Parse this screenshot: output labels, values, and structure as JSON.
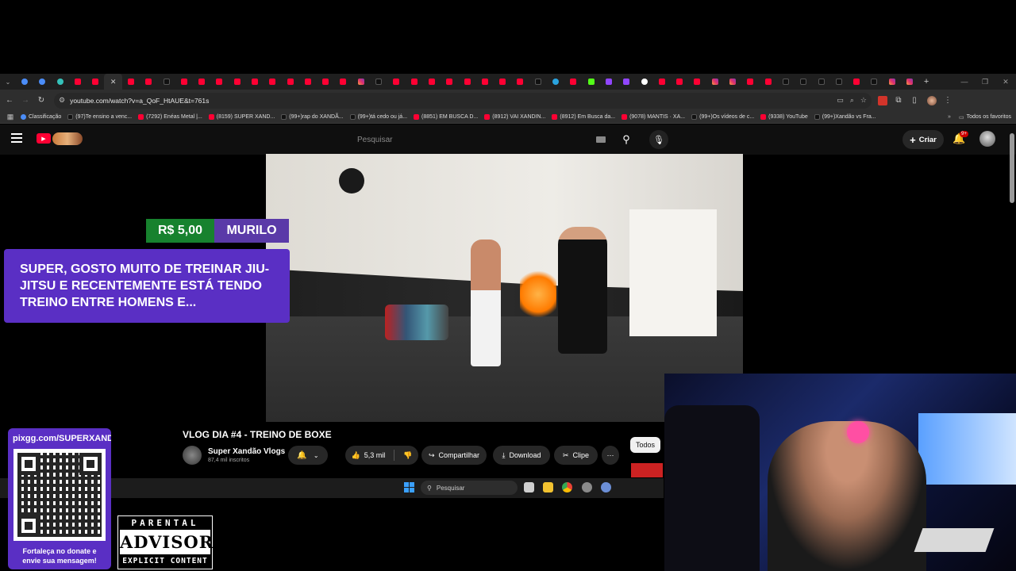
{
  "browser": {
    "url": "youtube.com/watch?v=a_QoF_HtAUE&t=761s",
    "tabs_favicons": [
      "link",
      "link",
      "ai",
      "yt",
      "yt",
      "close",
      "yt",
      "yt",
      "tt",
      "yt",
      "yt",
      "yt",
      "yt",
      "yt",
      "yt",
      "yt",
      "yt",
      "yt",
      "yt",
      "ig",
      "tt",
      "yt",
      "yt",
      "yt",
      "yt",
      "yt",
      "yt",
      "yt",
      "yt",
      "tt",
      "tg",
      "yt",
      "kick",
      "tw",
      "tw",
      "gg",
      "yt",
      "yt",
      "yt",
      "ig",
      "ig",
      "yt",
      "yt",
      "tt",
      "tt",
      "tt",
      "tt",
      "yt",
      "tt",
      "ig",
      "ig"
    ],
    "new_tab_label": "+",
    "all_bookmarks_label": "Todos os favoritos",
    "bookmarks": [
      {
        "icon": "link",
        "label": "Classificação"
      },
      {
        "icon": "tt",
        "label": "(97)Te ensino a venc..."
      },
      {
        "icon": "yt",
        "label": "(7292) Enéas Metal |..."
      },
      {
        "icon": "yt",
        "label": "(8159) SUPER XAND..."
      },
      {
        "icon": "tt",
        "label": "(99+)rap do XANDÃ..."
      },
      {
        "icon": "tt",
        "label": "(99+)tá cedo ou já..."
      },
      {
        "icon": "yt",
        "label": "(8851) EM BUSCA D..."
      },
      {
        "icon": "yt",
        "label": "(8912) VAI XANDIN..."
      },
      {
        "icon": "yt",
        "label": "(8912) Em Busca da..."
      },
      {
        "icon": "yt",
        "label": "(9078) MANTIS · XA..."
      },
      {
        "icon": "tt",
        "label": "(99+)Os vídeos de c..."
      },
      {
        "icon": "yt",
        "label": "(9338) YouTube"
      },
      {
        "icon": "tt",
        "label": "(99+)Xandão vs Fra..."
      }
    ]
  },
  "youtube": {
    "search_placeholder": "Pesquisar",
    "create_label": "Criar",
    "notifications_badge": "9+",
    "video": {
      "title": "VLOG DIA #4 - TREINO DE BOXE",
      "channel_name": "Super Xandão Vlogs",
      "subscribers": "87,4 mil inscritos",
      "likes": "5,3 mil",
      "share_label": "Compartilhar",
      "download_label": "Download",
      "clip_label": "Clipe"
    },
    "chip_label": "Todos"
  },
  "donation": {
    "amount": "R$ 5,00",
    "name": "MURILO",
    "message": "SUPER, GOSTO MUITO DE TREINAR JIU-JITSU E RECENTEMENTE ESTÁ TENDO TREINO ENTRE HOMENS E..."
  },
  "taskbar": {
    "search_placeholder": "Pesquisar"
  },
  "pix": {
    "url": "pixgg.com/SUPERXANDAO",
    "cta": "Fortaleça no donate e envie sua mensagem!"
  },
  "parental_advisory": {
    "top": "PARENTAL",
    "middle": "ADVISORY",
    "bottom": "EXPLICIT CONTENT"
  },
  "colors": {
    "donation_amount_bg": "#17822e",
    "donation_name_bg": "#5a3aa8",
    "donation_message_bg": "#5a2fc4",
    "youtube_red": "#ff0033"
  }
}
